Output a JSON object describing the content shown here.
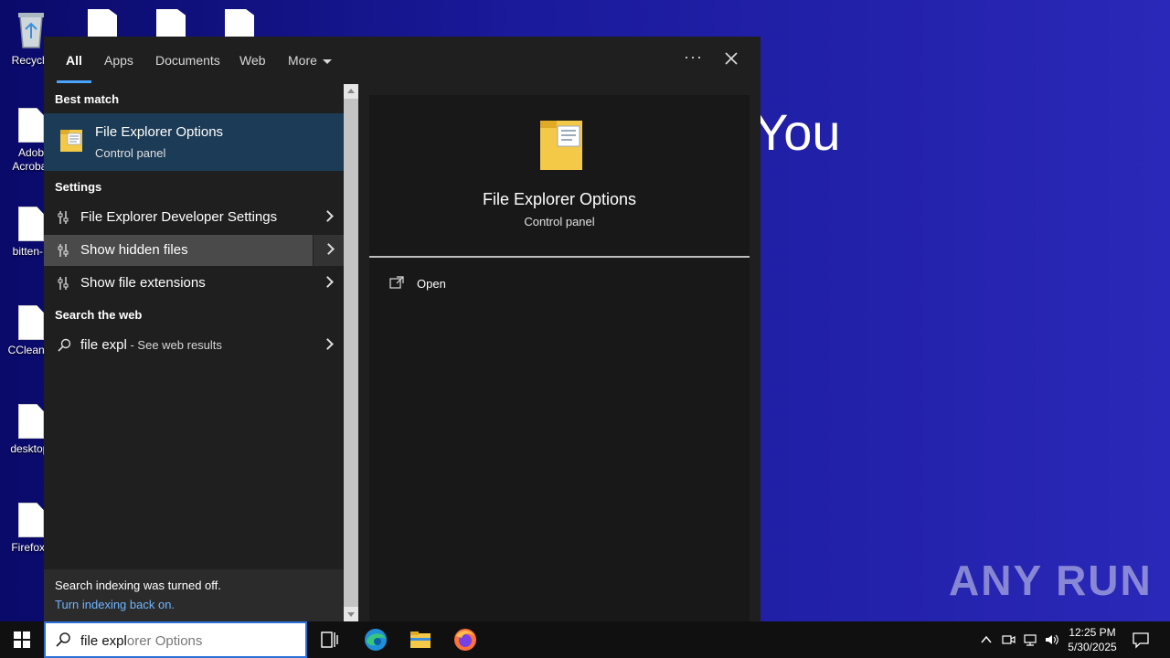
{
  "desktop": {
    "icons": [
      {
        "label": "Recycle"
      },
      {
        "label": "Adob Acrobat"
      },
      {
        "label": "bitten-F"
      },
      {
        "label": "CCleaner"
      },
      {
        "label": "desktop."
      },
      {
        "label": "Firefox.I"
      }
    ],
    "background_text": "You",
    "watermark": "ANY RUN"
  },
  "search": {
    "tabs": [
      "All",
      "Apps",
      "Documents",
      "Web",
      "More"
    ],
    "active_tab": "All",
    "best_match_header": "Best match",
    "best_match": {
      "title": "File Explorer Options",
      "subtitle": "Control panel"
    },
    "settings_header": "Settings",
    "settings": [
      {
        "label": "File Explorer Developer Settings"
      },
      {
        "label": "Show hidden files"
      },
      {
        "label": "Show file extensions"
      }
    ],
    "web_header": "Search the web",
    "web_result": {
      "query": "file expl",
      "suffix": " - See web results"
    },
    "indexing_notice": "Search indexing was turned off.",
    "indexing_link": "Turn indexing back on.",
    "preview": {
      "title": "File Explorer Options",
      "subtitle": "Control panel",
      "action": "Open"
    }
  },
  "taskbar": {
    "search_typed": "file expl",
    "search_ghost": "orer Options",
    "time": "12:25 PM",
    "date": "5/30/2025"
  },
  "colors": {
    "accent": "#4aa3ff",
    "selected_row": "#1c3b56",
    "link": "#6fb5ff"
  }
}
